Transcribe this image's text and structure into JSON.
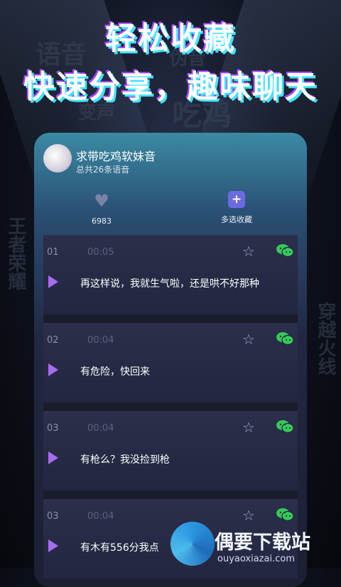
{
  "headline": {
    "line1": "轻松收藏",
    "line2": "快速分享，趣味聊天"
  },
  "background_words": [
    "语音",
    "伪音",
    "变声",
    "吃鸡",
    "王者荣耀",
    "穿越火线"
  ],
  "collection": {
    "title": "求带吃鸡软妹音",
    "subtitle": "总共26条语音",
    "like_count": "6983",
    "multi_select_label": "多选收藏"
  },
  "voices": [
    {
      "index": "01",
      "duration": "00:05",
      "text": "再这样说，我就生气啦，还是哄不好那种"
    },
    {
      "index": "02",
      "duration": "00:04",
      "text": "有危险，快回来"
    },
    {
      "index": "03",
      "duration": "00:04",
      "text": "有枪么？我没捡到枪"
    },
    {
      "index": "03",
      "duration": "00:04",
      "text": "有木有556分我点"
    }
  ],
  "watermark": {
    "title": "偶要下载站",
    "url": "ouyaoxiazai.com"
  },
  "colors": {
    "accent_purple": "#a86cf0",
    "wechat_green": "#36c95a",
    "headline_glow": "#3fe3ff"
  },
  "icons": {
    "favorite": "star-outline-icon",
    "share": "wechat-icon",
    "play": "play-icon",
    "like": "heart-icon",
    "multi_select": "folder-add-icon"
  }
}
